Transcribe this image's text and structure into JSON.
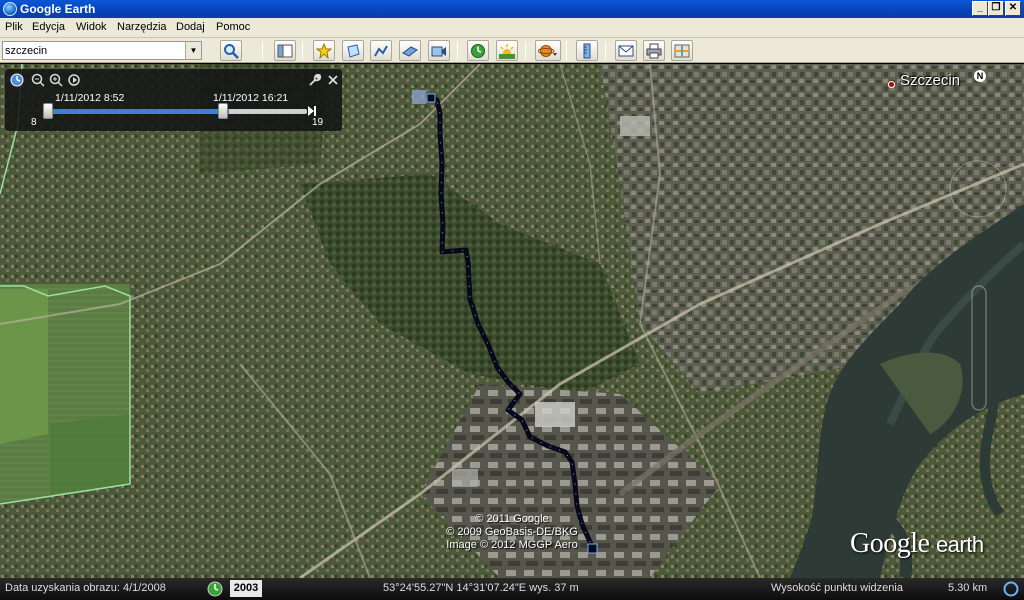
{
  "window": {
    "title": "Google Earth"
  },
  "menu": [
    "Plik",
    "Edycja",
    "Widok",
    "Narzędzia",
    "Dodaj",
    "Pomoc"
  ],
  "search": {
    "value": "szczecin"
  },
  "toolbar": {
    "icons": [
      "sidebar-toggle-icon",
      "placemark-icon",
      "polygon-icon",
      "path-icon",
      "image-overlay-icon",
      "record-tour-icon",
      "historical-imagery-icon",
      "sunlight-icon",
      "planets-icon",
      "ruler-icon",
      "email-icon",
      "print-icon",
      "google-maps-icon"
    ]
  },
  "time_slider": {
    "start_date": "1/11/2012   8:52",
    "end_date": "1/11/2012  16:21",
    "min_label": "8",
    "max_label": "19"
  },
  "map": {
    "city_label": "Szczecin",
    "north_label": "N",
    "copyright": [
      "© 2011 Google",
      "© 2009 GeoBasis-DE/BKG",
      "Image © 2012 MGGP Aero"
    ],
    "logo_google": "Google",
    "logo_earth": "earth"
  },
  "status": {
    "imagery_date": "Data uzyskania obrazu: 4/1/2008",
    "year": "2003",
    "coordinates": "53°24'55.27\"N   14°31'07.24\"E  wys.   37 m",
    "eye_alt_label": "Wysokość punktu widzenia",
    "eye_alt_value": "5.30 km"
  },
  "colors": {
    "titlebar": "#0843b8",
    "chrome": "#ece9d8",
    "track": "#0a0a14",
    "track_marker": "#6fb0ff",
    "city_dot": "#bb0000"
  }
}
